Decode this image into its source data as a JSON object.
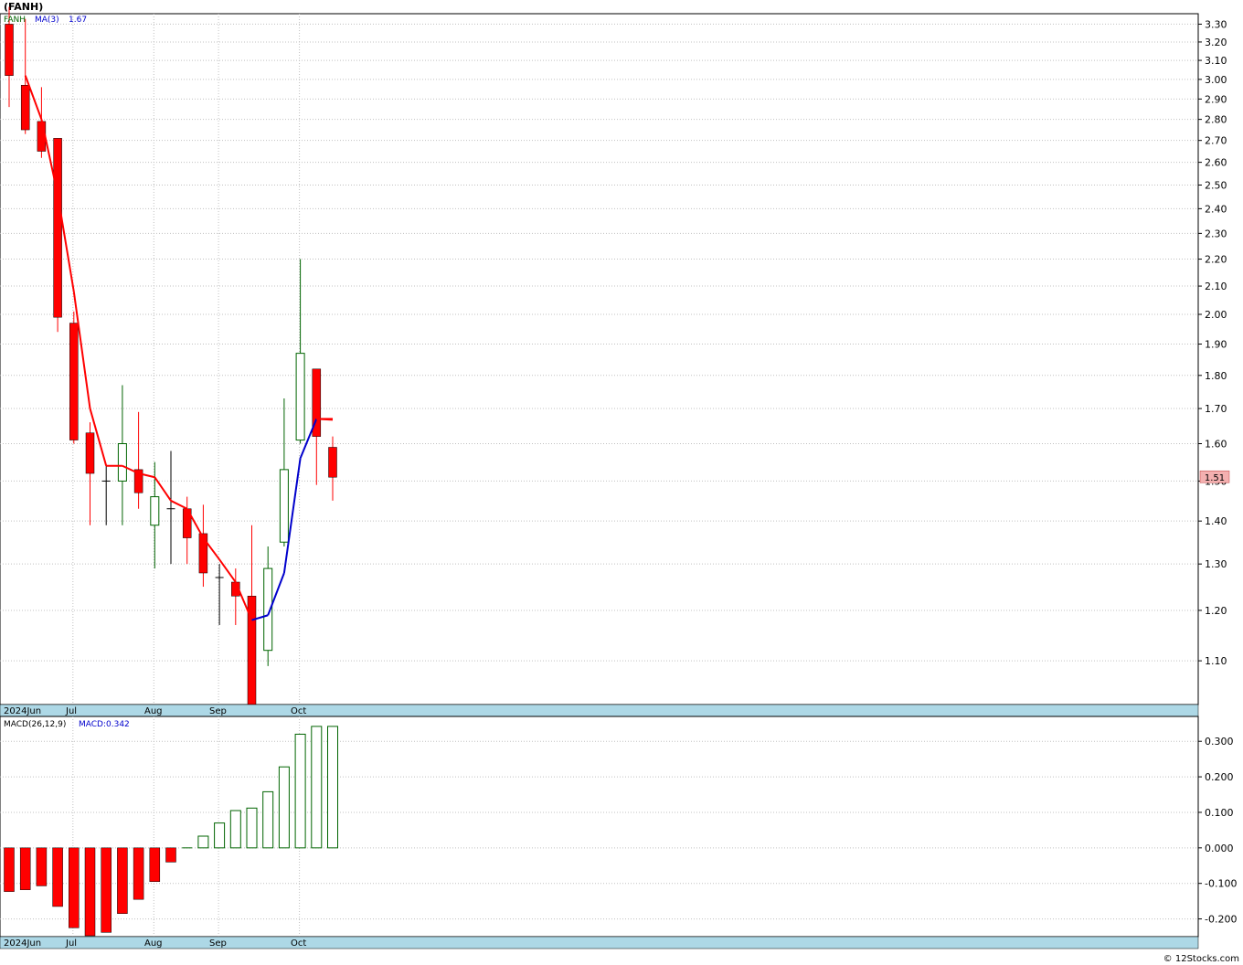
{
  "title": "(FANH)",
  "footer": "© 12Stocks.com",
  "price_panel": {
    "legend_symbol": "FANH",
    "legend_ma_label": "MA(3)",
    "legend_ma_value": "1.67",
    "last_price_label": "1.51",
    "y_ticks": [
      "3.30",
      "3.20",
      "3.10",
      "3.00",
      "2.90",
      "2.80",
      "2.70",
      "2.60",
      "2.50",
      "2.40",
      "2.30",
      "2.20",
      "2.10",
      "2.00",
      "1.90",
      "1.80",
      "1.70",
      "1.60",
      "1.50",
      "1.40",
      "1.30",
      "1.20",
      "1.10"
    ],
    "x_labels": [
      "2024Jun",
      "Jul",
      "Aug",
      "Sep",
      "Oct"
    ]
  },
  "macd_panel": {
    "legend_label": "MACD(26,12,9)",
    "legend_value": "MACD:0.342",
    "y_ticks": [
      "0.300",
      "0.200",
      "0.100",
      "0.000",
      "-0.100",
      "-0.200"
    ],
    "x_labels": [
      "2024Jun",
      "Jul",
      "Aug",
      "Sep",
      "Oct"
    ]
  },
  "colors": {
    "up": "#006400",
    "down": "#ff0000",
    "ma_down": "#ff0000",
    "ma_up": "#0000cc",
    "axis_bar": "#add8e6",
    "grid": "#c0c0c0"
  },
  "chart_data": [
    {
      "type": "candlestick",
      "title": "(FANH)",
      "y_scale": "log",
      "ylim": [
        1.02,
        3.36
      ],
      "x_labels": [
        "2024Jun",
        "Jul",
        "Aug",
        "Sep",
        "Oct"
      ],
      "candles": [
        {
          "o": 3.3,
          "h": 3.4,
          "l": 2.86,
          "c": 3.02
        },
        {
          "o": 2.97,
          "h": 3.33,
          "l": 2.73,
          "c": 2.75
        },
        {
          "o": 2.79,
          "h": 2.96,
          "l": 2.62,
          "c": 2.65
        },
        {
          "o": 2.71,
          "h": 2.71,
          "l": 1.94,
          "c": 1.99
        },
        {
          "o": 1.97,
          "h": 2.01,
          "l": 1.6,
          "c": 1.61
        },
        {
          "o": 1.63,
          "h": 1.66,
          "l": 1.39,
          "c": 1.52
        },
        {
          "o": 1.5,
          "h": 1.54,
          "l": 1.39,
          "c": 1.5
        },
        {
          "o": 1.5,
          "h": 1.77,
          "l": 1.39,
          "c": 1.6
        },
        {
          "o": 1.53,
          "h": 1.69,
          "l": 1.43,
          "c": 1.47
        },
        {
          "o": 1.39,
          "h": 1.55,
          "l": 1.29,
          "c": 1.46
        },
        {
          "o": 1.43,
          "h": 1.58,
          "l": 1.3,
          "c": 1.43
        },
        {
          "o": 1.43,
          "h": 1.46,
          "l": 1.3,
          "c": 1.36
        },
        {
          "o": 1.37,
          "h": 1.44,
          "l": 1.25,
          "c": 1.28
        },
        {
          "o": 1.27,
          "h": 1.3,
          "l": 1.17,
          "c": 1.27
        },
        {
          "o": 1.26,
          "h": 1.29,
          "l": 1.17,
          "c": 1.23
        },
        {
          "o": 1.23,
          "h": 1.39,
          "l": 0.98,
          "c": 0.98
        },
        {
          "o": 1.12,
          "h": 1.34,
          "l": 1.09,
          "c": 1.29
        },
        {
          "o": 1.35,
          "h": 1.73,
          "l": 1.34,
          "c": 1.53
        },
        {
          "o": 1.61,
          "h": 2.2,
          "l": 1.6,
          "c": 1.87
        },
        {
          "o": 1.82,
          "h": 1.82,
          "l": 1.49,
          "c": 1.62
        },
        {
          "o": 1.59,
          "h": 1.62,
          "l": 1.45,
          "c": 1.51
        }
      ],
      "ma3": [
        null,
        3.02,
        2.8,
        2.46,
        2.08,
        1.7,
        1.54,
        1.54,
        1.52,
        1.51,
        1.45,
        1.43,
        1.36,
        1.31,
        1.26,
        1.18,
        1.19,
        1.28,
        1.56,
        1.67,
        1.67
      ]
    },
    {
      "type": "bar",
      "title": "MACD(26,12,9)",
      "ylim": [
        -0.25,
        0.37
      ],
      "x_labels": [
        "2024Jun",
        "Jul",
        "Aug",
        "Sep",
        "Oct"
      ],
      "values": [
        -0.123,
        -0.118,
        -0.107,
        -0.165,
        -0.225,
        -0.248,
        -0.238,
        -0.185,
        -0.145,
        -0.095,
        -0.04,
        0.0,
        0.033,
        0.07,
        0.105,
        0.112,
        0.158,
        0.228,
        0.32,
        0.342,
        0.342
      ]
    }
  ]
}
